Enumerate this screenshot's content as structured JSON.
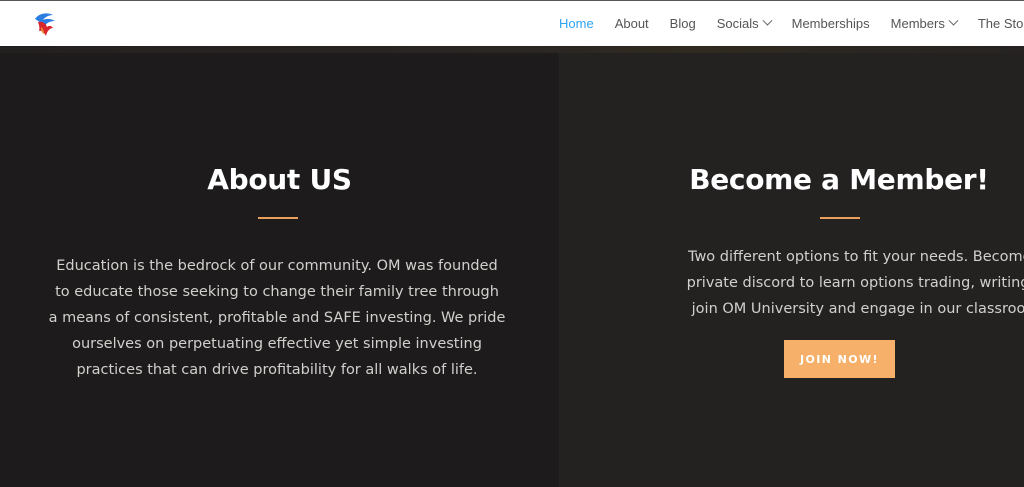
{
  "header": {
    "logo": {
      "icon": "om-flame-logo-icon",
      "colors": [
        "#d7262e",
        "#2b7de1"
      ]
    },
    "nav": [
      {
        "label": "Home",
        "active": true,
        "has_dropdown": false
      },
      {
        "label": "About",
        "active": false,
        "has_dropdown": false
      },
      {
        "label": "Blog",
        "active": false,
        "has_dropdown": false
      },
      {
        "label": "Socials",
        "active": false,
        "has_dropdown": true
      },
      {
        "label": "Memberships",
        "active": false,
        "has_dropdown": false
      },
      {
        "label": "Members",
        "active": false,
        "has_dropdown": true
      },
      {
        "label": "The Store",
        "active": false,
        "has_dropdown": false
      }
    ]
  },
  "about": {
    "title": "About US",
    "lines": [
      "Education is the bedrock of our community. OM was founded",
      "to educate those seeking to change their family tree through",
      "a means of consistent, profitable and SAFE investing. We pride",
      "ourselves on perpetuating effective yet simple investing",
      "practices that can drive profitability for all walks of life."
    ]
  },
  "member": {
    "title": "Become a Member!",
    "lines": [
      "Two different options to fit your needs. Become a part of",
      "private discord to learn options trading, writing premium",
      "join OM University and engage in our classroom setting"
    ],
    "button_label": "JOIN NOW!"
  },
  "colors": {
    "accent_active_nav": "#2ea3f2",
    "divider": "#e8a05c",
    "button_bg": "#f6b06a",
    "about_bg": "#1d1b1b",
    "member_bg": "#242121"
  }
}
